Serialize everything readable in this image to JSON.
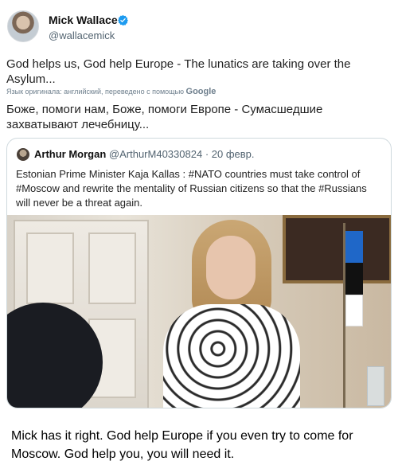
{
  "tweet": {
    "author_name": "Mick Wallace",
    "author_handle": "@wallacemick",
    "text": "God helps us, God help Europe - The lunatics are taking over the Asylum...",
    "translation_label": "Язык оригинала: английский, переведено с помощью",
    "translation_provider": "Google",
    "translated_text": "Боже, помоги нам, Боже, помоги Европе - Сумасшедшие захватывают лечебницу..."
  },
  "quote": {
    "author_name": "Arthur Morgan",
    "author_handle": "@ArthurM40330824",
    "separator": "·",
    "date": "20 февр.",
    "text": "Estonian Prime Minister Kaja Kallas : #NATO countries must take control of #Moscow and rewrite the mentality of Russian citizens so that the #Russians will never be a threat again."
  },
  "caption": "Mick has it right. God help Europe if you even try to come for Moscow. God help you, you will need it.",
  "icons": {
    "verified": "verified-badge-icon"
  },
  "colors": {
    "verified": "#1d9bf0",
    "meta_gray": "#536471",
    "border": "#cfd9de"
  }
}
